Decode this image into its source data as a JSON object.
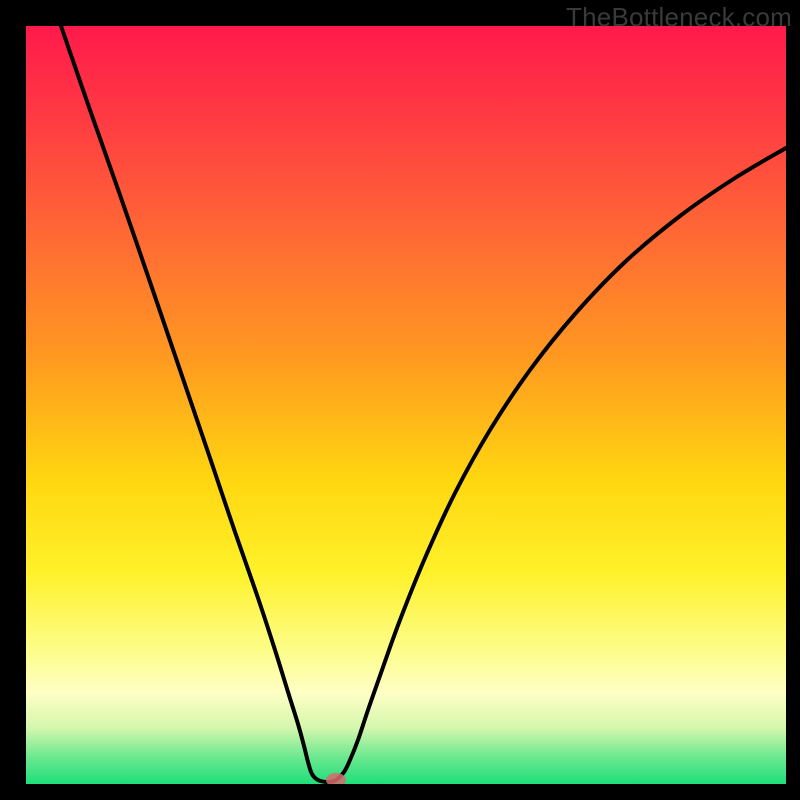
{
  "watermark": {
    "text": "TheBottleneck.com"
  },
  "chart_data": {
    "type": "line",
    "title": "",
    "xlabel": "",
    "ylabel": "",
    "xlim": [
      26,
      786
    ],
    "ylim": [
      26,
      784
    ],
    "background_gradient": {
      "stops": [
        {
          "offset": 0.0,
          "color": "#ff1a4b"
        },
        {
          "offset": 0.12,
          "color": "#ff3a43"
        },
        {
          "offset": 0.28,
          "color": "#ff6a34"
        },
        {
          "offset": 0.44,
          "color": "#ff9a20"
        },
        {
          "offset": 0.6,
          "color": "#ffd710"
        },
        {
          "offset": 0.72,
          "color": "#fff12a"
        },
        {
          "offset": 0.82,
          "color": "#fdfd86"
        },
        {
          "offset": 0.88,
          "color": "#feffc5"
        },
        {
          "offset": 0.925,
          "color": "#d6f7ad"
        },
        {
          "offset": 0.965,
          "color": "#6be890"
        },
        {
          "offset": 1.0,
          "color": "#1ede79"
        }
      ]
    },
    "series": [
      {
        "name": "curve",
        "points": [
          {
            "x": 61,
            "y": 26
          },
          {
            "x": 90,
            "y": 110
          },
          {
            "x": 120,
            "y": 195
          },
          {
            "x": 150,
            "y": 282
          },
          {
            "x": 180,
            "y": 370
          },
          {
            "x": 210,
            "y": 458
          },
          {
            "x": 235,
            "y": 532
          },
          {
            "x": 258,
            "y": 598
          },
          {
            "x": 275,
            "y": 650
          },
          {
            "x": 288,
            "y": 692
          },
          {
            "x": 298,
            "y": 724
          },
          {
            "x": 304,
            "y": 746
          },
          {
            "x": 308,
            "y": 762
          },
          {
            "x": 312,
            "y": 774
          },
          {
            "x": 318,
            "y": 780
          },
          {
            "x": 328,
            "y": 782
          },
          {
            "x": 336,
            "y": 780
          },
          {
            "x": 344,
            "y": 772
          },
          {
            "x": 350,
            "y": 760
          },
          {
            "x": 358,
            "y": 740
          },
          {
            "x": 368,
            "y": 710
          },
          {
            "x": 382,
            "y": 670
          },
          {
            "x": 400,
            "y": 620
          },
          {
            "x": 425,
            "y": 558
          },
          {
            "x": 455,
            "y": 493
          },
          {
            "x": 490,
            "y": 430
          },
          {
            "x": 530,
            "y": 370
          },
          {
            "x": 575,
            "y": 314
          },
          {
            "x": 625,
            "y": 262
          },
          {
            "x": 680,
            "y": 216
          },
          {
            "x": 735,
            "y": 178
          },
          {
            "x": 786,
            "y": 148
          }
        ]
      }
    ],
    "marker": {
      "cx": 336,
      "cy": 780,
      "rx": 10,
      "ry": 7
    },
    "grid": false,
    "legend": false
  }
}
